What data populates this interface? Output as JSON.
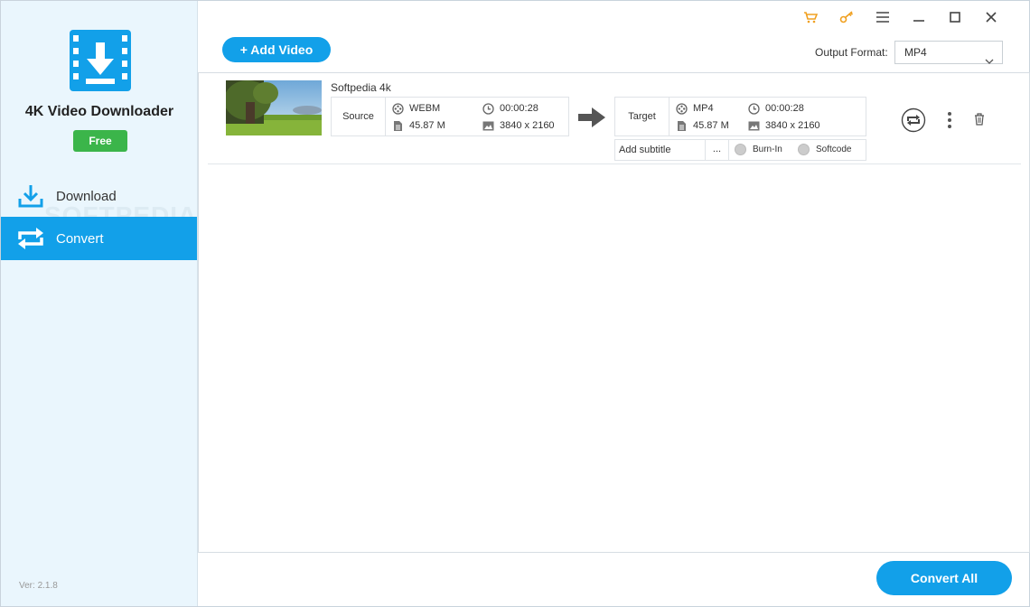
{
  "app": {
    "name": "4K Video Downloader",
    "badge": "Free",
    "version": "Ver: 2.1.8",
    "watermark": "SOFTPEDIA"
  },
  "sidebar": {
    "items": [
      {
        "label": "Download",
        "icon": "download-icon",
        "active": false
      },
      {
        "label": "Convert",
        "icon": "convert-icon",
        "active": true
      }
    ]
  },
  "titlebar": {
    "icons": [
      "cart-icon",
      "key-icon",
      "menu-icon",
      "minimize-icon",
      "maximize-icon",
      "close-icon"
    ],
    "accent": "#f0a020"
  },
  "toolbar": {
    "add_video": "+ Add Video",
    "output_label": "Output Format:",
    "output_value": "MP4"
  },
  "videos": [
    {
      "name": "Softpedia 4k",
      "source": {
        "label": "Source",
        "format": "WEBM",
        "duration": "00:00:28",
        "size": "45.87 M",
        "resolution": "3840 x 2160"
      },
      "target": {
        "label": "Target",
        "format": "MP4",
        "duration": "00:00:28",
        "size": "45.87 M",
        "resolution": "3840 x 2160"
      },
      "subtitle": {
        "placeholder": "Add subtitle",
        "more": "...",
        "options": [
          "Burn-In",
          "Softcode"
        ]
      }
    }
  ],
  "footer": {
    "convert_all": "Convert All"
  },
  "colors": {
    "primary": "#12a0e9",
    "badge": "#3bb54a",
    "sidebar_bg": "#eaf6fd"
  }
}
